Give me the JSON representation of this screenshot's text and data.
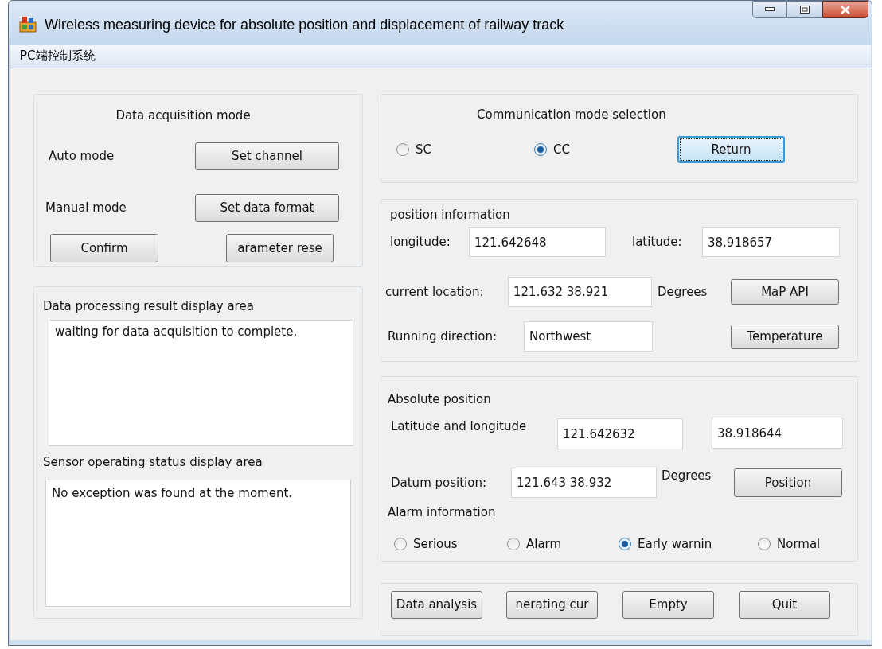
{
  "window": {
    "title": "Wireless measuring device for absolute position and displacement of railway track"
  },
  "menu_bar": [
    {
      "label": "PC端控制系统"
    }
  ],
  "data_acquisition_mode": {
    "title": "Data acquisition mode",
    "rows": [
      {
        "label": "Auto mode",
        "button": "Set channel"
      },
      {
        "label": "Manual mode",
        "button": "Set data format"
      }
    ],
    "buttons": [
      "Confirm",
      "arameter rese"
    ]
  },
  "display_areas": [
    {
      "label": "Data processing result display area",
      "text": "waiting for data acquisition to complete."
    },
    {
      "label": "Sensor operating status display area",
      "text": "No exception was found at the moment."
    }
  ],
  "communication_mode": {
    "title": "Communication mode selection",
    "options": [
      {
        "label": "SC",
        "selected": false
      },
      {
        "label": "CC",
        "selected": true
      }
    ],
    "button": {
      "label": "Return",
      "focused": true
    }
  },
  "position_information": {
    "title": "position information",
    "longitude": {
      "label": "longitude:",
      "value": "121.642648"
    },
    "latitude": {
      "label": "latitude:",
      "value": "38.918657"
    },
    "current_location": {
      "label": "current location:",
      "value": "121.632 38.921",
      "unit": "Degrees"
    },
    "running_direction": {
      "label": "Running direction:",
      "value": "Northwest"
    },
    "buttons": [
      "MaP API",
      "Temperature"
    ]
  },
  "absolute_position": {
    "title": "Absolute position",
    "lat_lon": {
      "label": "Latitude and longitude",
      "values": [
        "121.642632",
        "38.918644"
      ]
    },
    "datum_position": {
      "label": "Datum position:",
      "value": "121.643 38.932",
      "unit": "Degrees"
    },
    "position_button": "Position",
    "alarm": {
      "title": "Alarm information",
      "options": [
        {
          "label": "Serious",
          "selected": false
        },
        {
          "label": "Alarm",
          "selected": false
        },
        {
          "label": "Early warnin",
          "selected": true
        },
        {
          "label": "Normal",
          "selected": false
        }
      ]
    }
  },
  "action_buttons": [
    "Data analysis",
    "nerating cur",
    "Empty",
    "Quit"
  ]
}
